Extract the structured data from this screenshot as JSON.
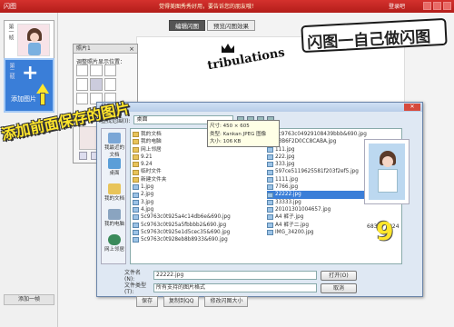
{
  "titlebar": {
    "app_title": "闪图",
    "center_text": "觉得美图秀秀好用，要告诉您的朋友哦！",
    "login": "登录吧"
  },
  "left": {
    "frame1_num": "第一帧",
    "frame1_pill": "替换",
    "frame2_num": "第二帧",
    "add_photo_label": "添加图片",
    "add_frame_label": "添加一帧"
  },
  "tabs": [
    {
      "label": "编辑闪图",
      "active": true
    },
    {
      "label": "预览闪图效果",
      "active": false
    }
  ],
  "canvas": {
    "logo_text": "tribulations"
  },
  "photo_panel": {
    "title": "照片1",
    "position_label": "调整照片显示位置："
  },
  "dialog": {
    "title": "打开",
    "path_label": "查找范围(I):",
    "path_value": "桌面",
    "places": [
      {
        "label": "我最近的文档"
      },
      {
        "label": "桌面"
      },
      {
        "label": "我的文档"
      },
      {
        "label": "我的电脑"
      },
      {
        "label": "网上邻居"
      }
    ],
    "files_col1": [
      {
        "name": "我的文档",
        "type": "folder"
      },
      {
        "name": "我的电脑",
        "type": "folder"
      },
      {
        "name": "网上邻居",
        "type": "folder"
      },
      {
        "name": "9.21",
        "type": "folder"
      },
      {
        "name": "9.24",
        "type": "folder"
      },
      {
        "name": "临时文件",
        "type": "folder"
      },
      {
        "name": "新建文件夹",
        "type": "folder"
      },
      {
        "name": "1.jpg",
        "type": "image"
      },
      {
        "name": "2.jpg",
        "type": "image"
      },
      {
        "name": "3.jpg",
        "type": "image"
      },
      {
        "name": "4.jpg",
        "type": "image"
      },
      {
        "name": "5c9763c0t925a4c14db6e&690.jpg",
        "type": "image"
      },
      {
        "name": "5c9763c0t925a5fbbbb2&690.jpg",
        "type": "image"
      },
      {
        "name": "5c9763c0t925e1d5cec35&690.jpg",
        "type": "image"
      },
      {
        "name": "5c9763c0t928eb8b8933&690.jpg",
        "type": "image"
      }
    ],
    "files_col2": [
      {
        "name": "5c9763c04929108439bbb&690.jpg",
        "type": "image"
      },
      {
        "name": "83B6F2D0CC8CABA.jpg",
        "type": "image"
      },
      {
        "name": "111.jpg",
        "type": "image"
      },
      {
        "name": "222.jpg",
        "type": "image"
      },
      {
        "name": "333.jpg",
        "type": "image"
      },
      {
        "name": "597ce5119625581f203f2ef5.jpg",
        "type": "image"
      },
      {
        "name": "1111.jpg",
        "type": "image"
      },
      {
        "name": "7766.jpg",
        "type": "image"
      },
      {
        "name": "22222.jpg",
        "type": "image",
        "selected": true
      },
      {
        "name": "33333.jpg",
        "type": "image"
      },
      {
        "name": "20101301004657.jpg",
        "type": "image"
      },
      {
        "name": "A4 裤子.jpg",
        "type": "image"
      },
      {
        "name": "A4 裤子二.jpg",
        "type": "image"
      },
      {
        "name": "IMG_34200.jpg",
        "type": "image"
      }
    ],
    "tooltip": [
      "尺寸: 450 × 605",
      "类型: Kankan JPEG 图像",
      "大小: 106 KB"
    ],
    "filename_label": "文件名(N):",
    "filename_value": "22222.jpg",
    "filetype_label": "文件类型(T):",
    "filetype_value": "所有支持的图片格式",
    "open_button": "打开(O)",
    "cancel_button": "取消",
    "size_info": "683 × 1024"
  },
  "bottom_buttons": [
    {
      "label": "保存"
    },
    {
      "label": "复制到QQ"
    },
    {
      "label": "修改闪图大小"
    }
  ],
  "annotations": {
    "top_right": "闪图一自己做闪图",
    "left": "添加前面保存的图片",
    "marker": "9"
  },
  "colors": {
    "titlebar": "#c8282a",
    "selection": "#3a7ed8",
    "annotation_yellow": "#ffe62b"
  }
}
